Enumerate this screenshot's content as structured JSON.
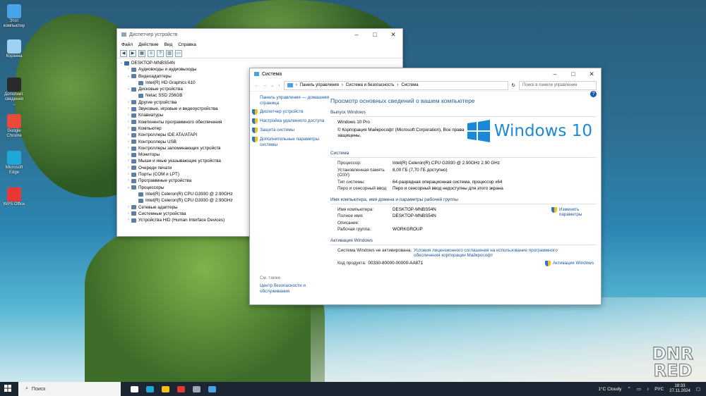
{
  "desktop": {
    "icons": [
      {
        "label": "Этот компьютер",
        "color": "#4aa3e6"
      },
      {
        "label": "Корзина",
        "color": "#9fd0f2"
      },
      {
        "label": "Дополнит. сведения ...",
        "color": "#2b2b2b"
      },
      {
        "label": "Google Chrome",
        "color": "#e84b3a"
      },
      {
        "label": "Microsoft Edge",
        "color": "#1fa7d8"
      },
      {
        "label": "WPS Office",
        "color": "#e53935"
      }
    ]
  },
  "device_manager": {
    "title": "Диспетчер устройств",
    "menu": [
      "Файл",
      "Действие",
      "Вид",
      "Справка"
    ],
    "tree": [
      {
        "label": "DESKTOP-MNBS54N",
        "expander": "⌄",
        "level": 0
      },
      {
        "label": "Аудиовходы и аудиовыходы",
        "expander": "›",
        "level": 1
      },
      {
        "label": "Видеоадаптеры",
        "expander": "⌄",
        "level": 1
      },
      {
        "label": "Intel(R) HD Graphics 610",
        "expander": "",
        "level": 2
      },
      {
        "label": "Дисковые устройства",
        "expander": "⌄",
        "level": 1
      },
      {
        "label": "Netac SSD 256GB",
        "expander": "",
        "level": 2
      },
      {
        "label": "Другие устройства",
        "expander": "›",
        "level": 1
      },
      {
        "label": "Звуковые, игровые и видеоустройства",
        "expander": "›",
        "level": 1
      },
      {
        "label": "Клавиатуры",
        "expander": "›",
        "level": 1
      },
      {
        "label": "Компоненты программного обеспечения",
        "expander": "›",
        "level": 1
      },
      {
        "label": "Компьютер",
        "expander": "›",
        "level": 1
      },
      {
        "label": "Контроллеры IDE ATA/ATAPI",
        "expander": "›",
        "level": 1
      },
      {
        "label": "Контроллеры USB",
        "expander": "›",
        "level": 1
      },
      {
        "label": "Контроллеры запоминающих устройств",
        "expander": "›",
        "level": 1
      },
      {
        "label": "Мониторы",
        "expander": "›",
        "level": 1
      },
      {
        "label": "Мыши и иные указывающие устройства",
        "expander": "›",
        "level": 1
      },
      {
        "label": "Очереди печати",
        "expander": "›",
        "level": 1
      },
      {
        "label": "Порты (COM и LPT)",
        "expander": "›",
        "level": 1
      },
      {
        "label": "Программные устройства",
        "expander": "›",
        "level": 1
      },
      {
        "label": "Процессоры",
        "expander": "⌄",
        "level": 1
      },
      {
        "label": "Intel(R) Celeron(R) CPU G3930 @ 2.90GHz",
        "expander": "",
        "level": 2
      },
      {
        "label": "Intel(R) Celeron(R) CPU G3930 @ 2.90GHz",
        "expander": "",
        "level": 2
      },
      {
        "label": "Сетевые адаптеры",
        "expander": "›",
        "level": 1
      },
      {
        "label": "Системные устройства",
        "expander": "›",
        "level": 1
      },
      {
        "label": "Устройства HID (Human Interface Devices)",
        "expander": "›",
        "level": 1
      }
    ]
  },
  "system": {
    "title": "Система",
    "breadcrumb": [
      "Панель управления",
      "Система и безопасность",
      "Система"
    ],
    "search_placeholder": "Поиск в панели управления",
    "left_home": "Панель управления — домашняя страница",
    "left_links": [
      "Диспетчер устройств",
      "Настройка удаленного доступа",
      "Защита системы",
      "Дополнительные параметры системы"
    ],
    "see_also": "См. также",
    "see_also_link": "Центр безопасности и обслуживания",
    "heading": "Просмотр основных сведений о вашем компьютере",
    "edition_section": "Выпуск Windows",
    "edition": "Windows 10 Pro",
    "copyright": "© Корпорация Майкрософт (Microsoft Corporation), Все права защищены.",
    "logo_text": "Windows 10",
    "system_section": "Система",
    "system_rows": [
      {
        "k": "Процессор:",
        "v": "Intel(R) Celeron(R) CPU G3930 @ 2.90GHz   2.90 GHz"
      },
      {
        "k": "Установленная память (ОЗУ):",
        "v": "8,00 ГБ (7,70 ГБ доступно)"
      },
      {
        "k": "Тип системы:",
        "v": "64-разрядная операционная система, процессор x64"
      },
      {
        "k": "Перо и сенсорный ввод",
        "v": "Перо и сенсорный ввод недоступны для этого экрана"
      }
    ],
    "name_section": "Имя компьютера, имя домена и параметры рабочей группы",
    "name_rows": [
      {
        "k": "Имя компьютера:",
        "v": "DESKTOP-MNBS54N"
      },
      {
        "k": "Полное имя:",
        "v": "DESKTOP-MNBS54N"
      },
      {
        "k": "Описание:",
        "v": ""
      },
      {
        "k": "Рабочая группа:",
        "v": "WORKGROUP"
      }
    ],
    "change_params": "Изменить параметры",
    "activation_section": "Активация Windows",
    "activation_status": "Система Windows не активирована.",
    "license_link": "Условия лицензионного соглашения на использование программного обеспечения корпорации Майкрософт",
    "product_code_label": "Код продукта:",
    "product_code": "00330-80000-00000-AA871",
    "activation_link": "Активация Windows"
  },
  "taskbar": {
    "search_label": "Поиск",
    "weather": "1°C  Cloudy",
    "lang": "РУС",
    "time": "18:33",
    "date": "27.11.2024",
    "apps": [
      {
        "name": "task-view",
        "color": "#ffffff"
      },
      {
        "name": "edge",
        "color": "#1fa7d8"
      },
      {
        "name": "explorer",
        "color": "#f2c21a"
      },
      {
        "name": "store",
        "color": "#e53935"
      },
      {
        "name": "device-manager",
        "color": "#9aa7b5"
      },
      {
        "name": "control-panel",
        "color": "#4aa3e6"
      }
    ]
  },
  "watermark": "DNR RED"
}
